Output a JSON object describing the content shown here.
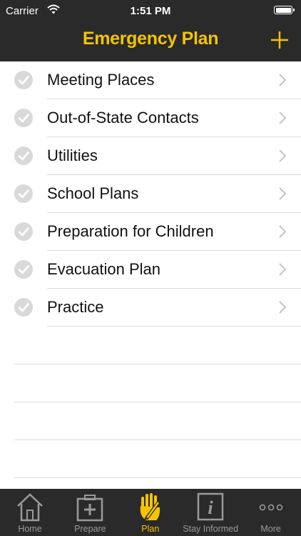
{
  "status_bar": {
    "carrier": "Carrier",
    "time": "1:51 PM"
  },
  "nav": {
    "title": "Emergency Plan",
    "add_icon": "plus-icon"
  },
  "items": [
    {
      "label": "Meeting Places"
    },
    {
      "label": "Out-of-State Contacts"
    },
    {
      "label": "Utilities"
    },
    {
      "label": "School Plans"
    },
    {
      "label": "Preparation for Children"
    },
    {
      "label": "Evacuation Plan"
    },
    {
      "label": "Practice"
    }
  ],
  "tabs": [
    {
      "label": "Home",
      "icon": "house-icon",
      "active": false
    },
    {
      "label": "Prepare",
      "icon": "first-aid-kit-icon",
      "active": false
    },
    {
      "label": "Plan",
      "icon": "hand-pencil-icon",
      "active": true
    },
    {
      "label": "Stay Informed",
      "icon": "info-icon",
      "active": false
    },
    {
      "label": "More",
      "icon": "ellipsis-icon",
      "active": false
    }
  ],
  "colors": {
    "accent": "#f5c400",
    "bar_background": "#2a2a2a",
    "inactive_tab": "#9a9a9a",
    "check_gray": "#d9d9d9"
  }
}
